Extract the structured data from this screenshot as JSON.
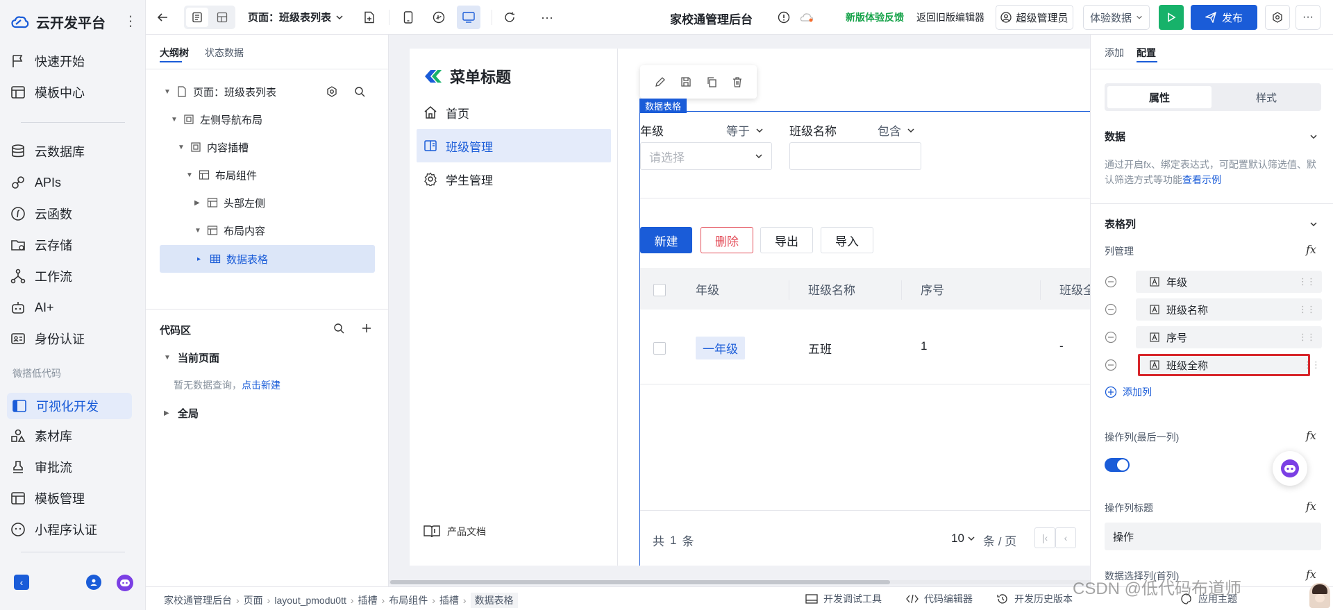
{
  "app": {
    "name": "云开发平台",
    "more": "⋮"
  },
  "nav": {
    "items": [
      {
        "label": "快速开始",
        "icon": "flag-icon"
      },
      {
        "label": "模板中心",
        "icon": "template-icon"
      },
      {
        "label": "云数据库",
        "icon": "database-icon"
      },
      {
        "label": "APIs",
        "icon": "link-icon"
      },
      {
        "label": "云函数",
        "icon": "function-icon"
      },
      {
        "label": "云存储",
        "icon": "folder-icon"
      },
      {
        "label": "工作流",
        "icon": "workflow-icon"
      },
      {
        "label": "AI+",
        "icon": "robot-icon"
      },
      {
        "label": "身份认证",
        "icon": "id-card-icon"
      }
    ],
    "section_label": "微搭低代码",
    "lowcode_items": [
      {
        "label": "可视化开发",
        "icon": "layout-icon",
        "active": true
      },
      {
        "label": "素材库",
        "icon": "shapes-icon"
      },
      {
        "label": "审批流",
        "icon": "stamp-icon"
      },
      {
        "label": "模板管理",
        "icon": "template-icon"
      },
      {
        "label": "小程序认证",
        "icon": "miniprogram-icon"
      }
    ]
  },
  "topbar": {
    "page_label": "页面：班级表列表",
    "app_title": "家校通管理后台",
    "feedback": "新版体验反馈",
    "old_editor": "返回旧版编辑器",
    "admin": "超级管理员",
    "experience_data": "体验数据",
    "publish": "发布",
    "colors": {
      "accent": "#1a5cd8",
      "run": "#17b26a",
      "feedback": "#17a34a"
    }
  },
  "outline": {
    "tabs": [
      "大纲树",
      "状态数据"
    ],
    "tree": [
      {
        "label": "页面：班级表列表",
        "depth": 0
      },
      {
        "label": "左侧导航布局",
        "depth": 1
      },
      {
        "label": "内容插槽",
        "depth": 2
      },
      {
        "label": "布局组件",
        "depth": 3
      },
      {
        "label": "头部左侧",
        "depth": 4
      },
      {
        "label": "布局内容",
        "depth": 4
      },
      {
        "label": "数据表格",
        "depth": 5,
        "selected": true
      }
    ],
    "code_title": "代码区",
    "current_page": "当前页面",
    "empty_text": "暂无数据查询，",
    "create_link": "点击新建",
    "global": "全局"
  },
  "preview": {
    "menu_title": "菜单标题",
    "menu": [
      {
        "label": "首页",
        "icon": "home-icon"
      },
      {
        "label": "班级管理",
        "icon": "book-icon",
        "active": true
      },
      {
        "label": "学生管理",
        "icon": "settings-icon"
      }
    ],
    "docs": "产品文档",
    "component_tag": "数据表格",
    "filter": {
      "field1": "年级",
      "op1": "等于",
      "select_placeholder": "请选择",
      "field2": "班级名称",
      "op2": "包含"
    },
    "buttons": [
      "新建",
      "删除",
      "导出",
      "导入"
    ],
    "table": {
      "headers": [
        "年级",
        "班级名称",
        "序号",
        "班级全"
      ],
      "rows": [
        [
          "一年级",
          "五班",
          "1",
          "-"
        ]
      ]
    },
    "pagination": {
      "total_prefix": "共",
      "total": "1",
      "total_suffix": "条",
      "page_size": "10",
      "per_page": "条 / 页"
    }
  },
  "right": {
    "tabs": [
      "添加",
      "配置"
    ],
    "subtabs": [
      "属性",
      "样式"
    ],
    "data_title": "数据",
    "data_desc": "通过开启fx、绑定表达式，可配置默认筛选值、默认筛选方式等功能",
    "data_link": "查看示例",
    "columns_title": "表格列",
    "col_mgmt": "列管理",
    "columns": [
      "年级",
      "班级名称",
      "序号",
      "班级全称"
    ],
    "add_col": "添加列",
    "op_col": "操作列(最后一列)",
    "op_toggle": true,
    "op_title_label": "操作列标题",
    "op_title_value": "操作",
    "select_col": "数据选择列(首列)"
  },
  "bottom": {
    "breadcrumb": [
      "家校通管理后台",
      "页面",
      "layout_pmodu0tt",
      "插槽",
      "布局组件",
      "插槽",
      "数据表格"
    ],
    "tools": [
      "开发调试工具",
      "代码编辑器",
      "开发历史版本",
      "应用主题"
    ],
    "watermark": "CSDN @低代码布道师"
  }
}
